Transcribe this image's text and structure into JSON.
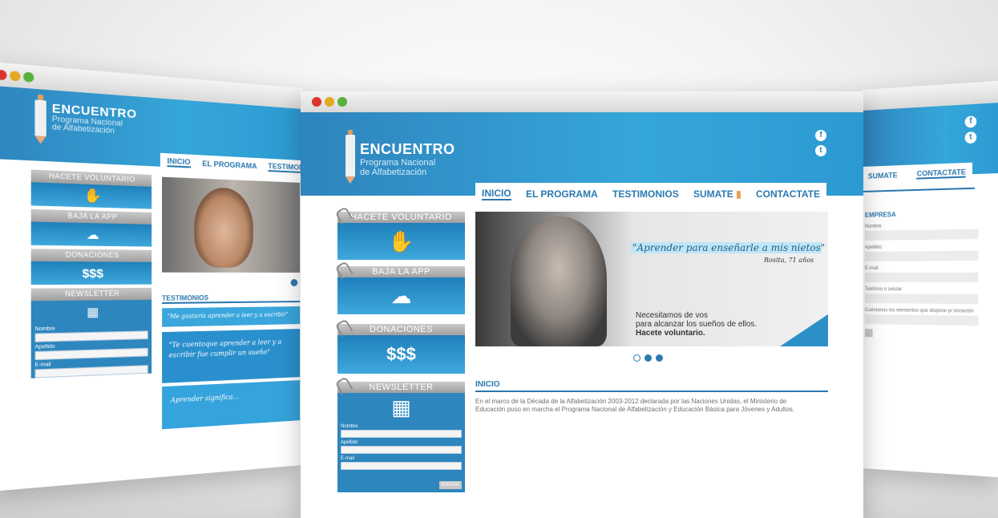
{
  "brand": {
    "name": "ENCUENTRO",
    "subtitle_line1": "Programa Nacional",
    "subtitle_line2": "de Alfabetización"
  },
  "social": {
    "facebook": "f",
    "twitter": "t"
  },
  "nav": {
    "inicio": "INICIO",
    "programa": "EL PROGRAMA",
    "testimonios": "TESTIMONIOS",
    "sumate": "SUMATE",
    "contactate": "CONTACTATE"
  },
  "widgets": {
    "voluntario": "HACETE VOLUNTARIO",
    "app": "BAJA LA APP",
    "donaciones": "DONACIONES",
    "donaciones_icon": "$$$",
    "newsletter": "NEWSLETTER"
  },
  "newsletter_form": {
    "nombre": "Nombre",
    "apellido": "Apellido",
    "email": "E-mail",
    "send": "ENVIAR"
  },
  "hero": {
    "quote": "\"Aprender para enseñarle a mis nietos\"",
    "quote_author": "Rosita, 71 años",
    "line1": "Necesitamos de vos",
    "line2": "para alcanzar los sueños de ellos.",
    "cta": "Hacete voluntario."
  },
  "inicio": {
    "title": "INICIO",
    "text": "En el marco de la Década de la Alfabetización 2003-2012 declarada por las Naciones Unidas, el Ministerio de Educación puso en marcha el Programa Nacional de Alfabetización y Educación Básica para Jóvenes y Adultos."
  },
  "left_window": {
    "testimonios_title": "TESTIMONIOS",
    "quote1": "\"Me gustaría aprender a leer y a escribir\"",
    "quote2": "\"Te cuentoque aprender a leer y a escribir fue cumplir un sueño\"",
    "quote3": "Aprender significa..."
  },
  "right_window": {
    "form_title": "EMPRESA",
    "field1": "Nombre",
    "field2": "Apellido",
    "field3": "E-mail",
    "field4": "Teléfono o celular",
    "field5": "Cuéntanos los elementos que dispone p/ donación"
  },
  "colors": {
    "accent": "#2b79b0",
    "header": "#35a6d9",
    "widget_title": "#b0b0b0"
  }
}
